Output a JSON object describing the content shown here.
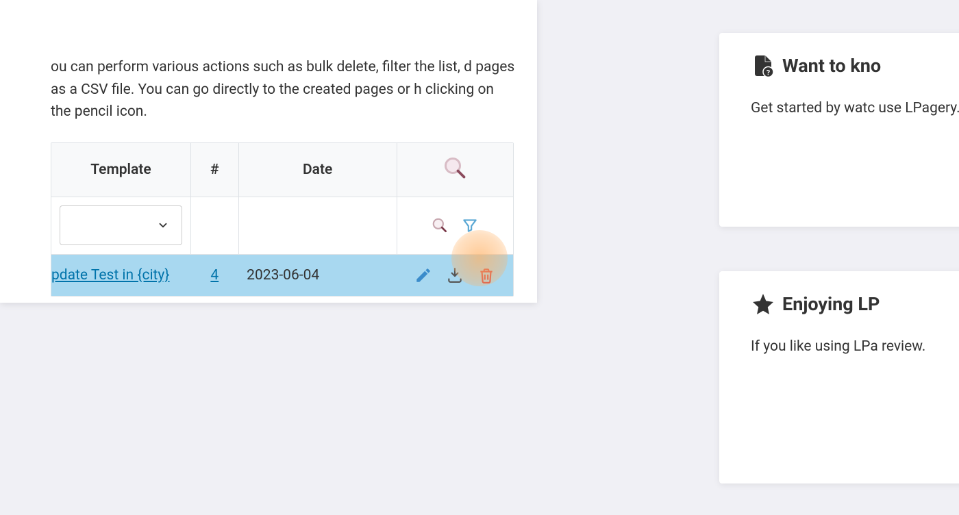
{
  "description": "ou can perform various actions such as bulk delete, filter the list, d pages as a CSV file. You can go directly to the created pages or h clicking on the pencil icon.",
  "table": {
    "headers": {
      "template": "Template",
      "hash": "#",
      "date": "Date"
    },
    "row": {
      "template_link": "pdate Test in {city}",
      "count": "4",
      "date": "2023-06-04"
    }
  },
  "sidebar": {
    "card1": {
      "title": "Want to kno",
      "text": "Get started by watc use LPagery."
    },
    "card2": {
      "title": "Enjoying LP",
      "text": "If you like using LPa review."
    }
  }
}
